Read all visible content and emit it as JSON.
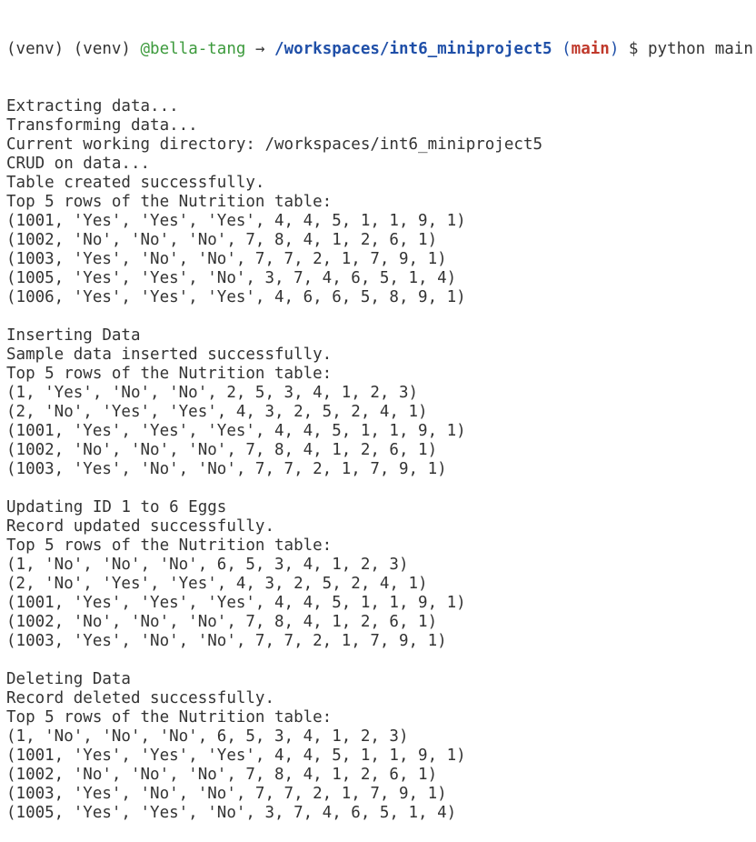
{
  "prompt": {
    "venv": "(venv) (venv) ",
    "user": "@bella-tang",
    "arrow": " → ",
    "path": "/workspaces/int6_miniproject5",
    "branch_open": " (",
    "branch": "main",
    "branch_close": ")",
    "command": " $ python main.py"
  },
  "output_lines": [
    "Extracting data...",
    "Transforming data...",
    "Current working directory: /workspaces/int6_miniproject5",
    "CRUD on data...",
    "Table created successfully.",
    "Top 5 rows of the Nutrition table:",
    "(1001, 'Yes', 'Yes', 'Yes', 4, 4, 5, 1, 1, 9, 1)",
    "(1002, 'No', 'No', 'No', 7, 8, 4, 1, 2, 6, 1)",
    "(1003, 'Yes', 'No', 'No', 7, 7, 2, 1, 7, 9, 1)",
    "(1005, 'Yes', 'Yes', 'No', 3, 7, 4, 6, 5, 1, 4)",
    "(1006, 'Yes', 'Yes', 'Yes', 4, 6, 6, 5, 8, 9, 1)",
    "",
    "Inserting Data",
    "Sample data inserted successfully.",
    "Top 5 rows of the Nutrition table:",
    "(1, 'Yes', 'No', 'No', 2, 5, 3, 4, 1, 2, 3)",
    "(2, 'No', 'Yes', 'Yes', 4, 3, 2, 5, 2, 4, 1)",
    "(1001, 'Yes', 'Yes', 'Yes', 4, 4, 5, 1, 1, 9, 1)",
    "(1002, 'No', 'No', 'No', 7, 8, 4, 1, 2, 6, 1)",
    "(1003, 'Yes', 'No', 'No', 7, 7, 2, 1, 7, 9, 1)",
    "",
    "Updating ID 1 to 6 Eggs",
    "Record updated successfully.",
    "Top 5 rows of the Nutrition table:",
    "(1, 'No', 'No', 'No', 6, 5, 3, 4, 1, 2, 3)",
    "(2, 'No', 'Yes', 'Yes', 4, 3, 2, 5, 2, 4, 1)",
    "(1001, 'Yes', 'Yes', 'Yes', 4, 4, 5, 1, 1, 9, 1)",
    "(1002, 'No', 'No', 'No', 7, 8, 4, 1, 2, 6, 1)",
    "(1003, 'Yes', 'No', 'No', 7, 7, 2, 1, 7, 9, 1)",
    "",
    "Deleting Data",
    "Record deleted successfully.",
    "Top 5 rows of the Nutrition table:",
    "(1, 'No', 'No', 'No', 6, 5, 3, 4, 1, 2, 3)",
    "(1001, 'Yes', 'Yes', 'Yes', 4, 4, 5, 1, 1, 9, 1)",
    "(1002, 'No', 'No', 'No', 7, 8, 4, 1, 2, 6, 1)",
    "(1003, 'Yes', 'No', 'No', 7, 7, 2, 1, 7, 9, 1)",
    "(1005, 'Yes', 'Yes', 'No', 3, 7, 4, 6, 5, 1, 4)"
  ],
  "colors": {
    "background": "#ffffff",
    "text": "#333333",
    "user": "#3c9a3c",
    "path": "#1f4fa8",
    "branch": "#c0392b"
  }
}
